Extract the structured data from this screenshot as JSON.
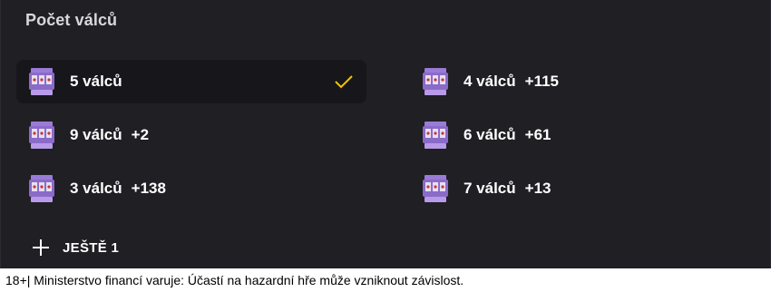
{
  "filter": {
    "title": "Počet válců",
    "options_left": [
      {
        "label": "5 válců",
        "count": "",
        "selected": true
      },
      {
        "label": "9 válců",
        "count": "+2",
        "selected": false
      },
      {
        "label": "3 válců",
        "count": "+138",
        "selected": false
      }
    ],
    "options_right": [
      {
        "label": "4 válců",
        "count": "+115",
        "selected": false
      },
      {
        "label": "6 válců",
        "count": "+61",
        "selected": false
      },
      {
        "label": "7 válců",
        "count": "+13",
        "selected": false
      }
    ],
    "more_label": "JEŠTĚ 1",
    "icons": {
      "option": "slot-machine-icon",
      "selected": "checkmark-icon",
      "more": "plus-icon"
    },
    "colors": {
      "background": "#1f1f24",
      "selected_background": "#17171b",
      "check": "#f5c400",
      "slot_icon": "#9a7bd8"
    }
  },
  "footer": {
    "disclaimer": "18+| Ministerstvo financí varuje: Účastí na hazardní hře může vzniknout závislost."
  }
}
